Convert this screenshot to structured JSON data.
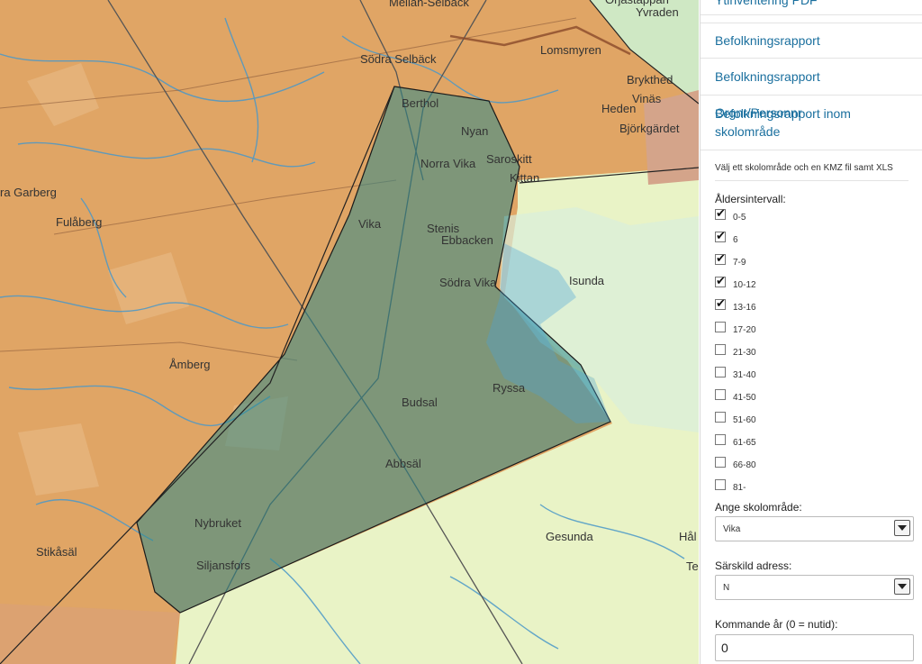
{
  "map": {
    "labels": [
      {
        "text": "Mellan-Selbäck"
      },
      {
        "text": "Orjastappan"
      },
      {
        "text": "Yvraden"
      },
      {
        "text": "Lomsmyren"
      },
      {
        "text": "Södra Selbäck"
      },
      {
        "text": "Brykthed"
      },
      {
        "text": "Vinäs"
      },
      {
        "text": "Heden"
      },
      {
        "text": "Björkgärdet"
      },
      {
        "text": "Berthol"
      },
      {
        "text": "Nyan"
      },
      {
        "text": "Norra Vika"
      },
      {
        "text": "Saroskitt"
      },
      {
        "text": "Kittan"
      },
      {
        "text": "ra Garberg"
      },
      {
        "text": "Fulåberg"
      },
      {
        "text": "Vika"
      },
      {
        "text": "Stenis"
      },
      {
        "text": "Ebbacken"
      },
      {
        "text": "Södra Vika"
      },
      {
        "text": "Isunda"
      },
      {
        "text": "Åmberg"
      },
      {
        "text": "Ryssa"
      },
      {
        "text": "Budsal"
      },
      {
        "text": "Abbsäl"
      },
      {
        "text": "Nybruket"
      },
      {
        "text": "Stikåsäl"
      },
      {
        "text": "Siljansfors"
      },
      {
        "text": "Gesunda"
      },
      {
        "text": "Hål"
      },
      {
        "text": "Te"
      }
    ],
    "colors": {
      "forest": "#e2a866",
      "lake_edge": "#cfe6f4",
      "water": "#4aa3d9",
      "open": "#e8f3c2",
      "selection": "#2d8a8a"
    }
  },
  "panel": {
    "links": [
      "Ytinventering PDF",
      "Befolkningsrapport",
      "Befolkningsrapport Orgnr/Personnr",
      "Befolkningsrapport inom skolområde"
    ],
    "help": "Välj ett skolområde och en KMZ fil samt XLS",
    "age_label": "Åldersintervall:",
    "ages": [
      {
        "label": "0-5",
        "checked": true
      },
      {
        "label": "6",
        "checked": true
      },
      {
        "label": "7-9",
        "checked": true
      },
      {
        "label": "10-12",
        "checked": true
      },
      {
        "label": "13-16",
        "checked": true
      },
      {
        "label": "17-20",
        "checked": false
      },
      {
        "label": "21-30",
        "checked": false
      },
      {
        "label": "31-40",
        "checked": false
      },
      {
        "label": "41-50",
        "checked": false
      },
      {
        "label": "51-60",
        "checked": false
      },
      {
        "label": "61-65",
        "checked": false
      },
      {
        "label": "66-80",
        "checked": false
      },
      {
        "label": "81-",
        "checked": false
      }
    ],
    "school_label": "Ange skolområde:",
    "school_value": "Vika",
    "address_label": "Särskild adress:",
    "address_value": "N",
    "year_label": "Kommande år (0 = nutid):",
    "year_value": "0"
  }
}
